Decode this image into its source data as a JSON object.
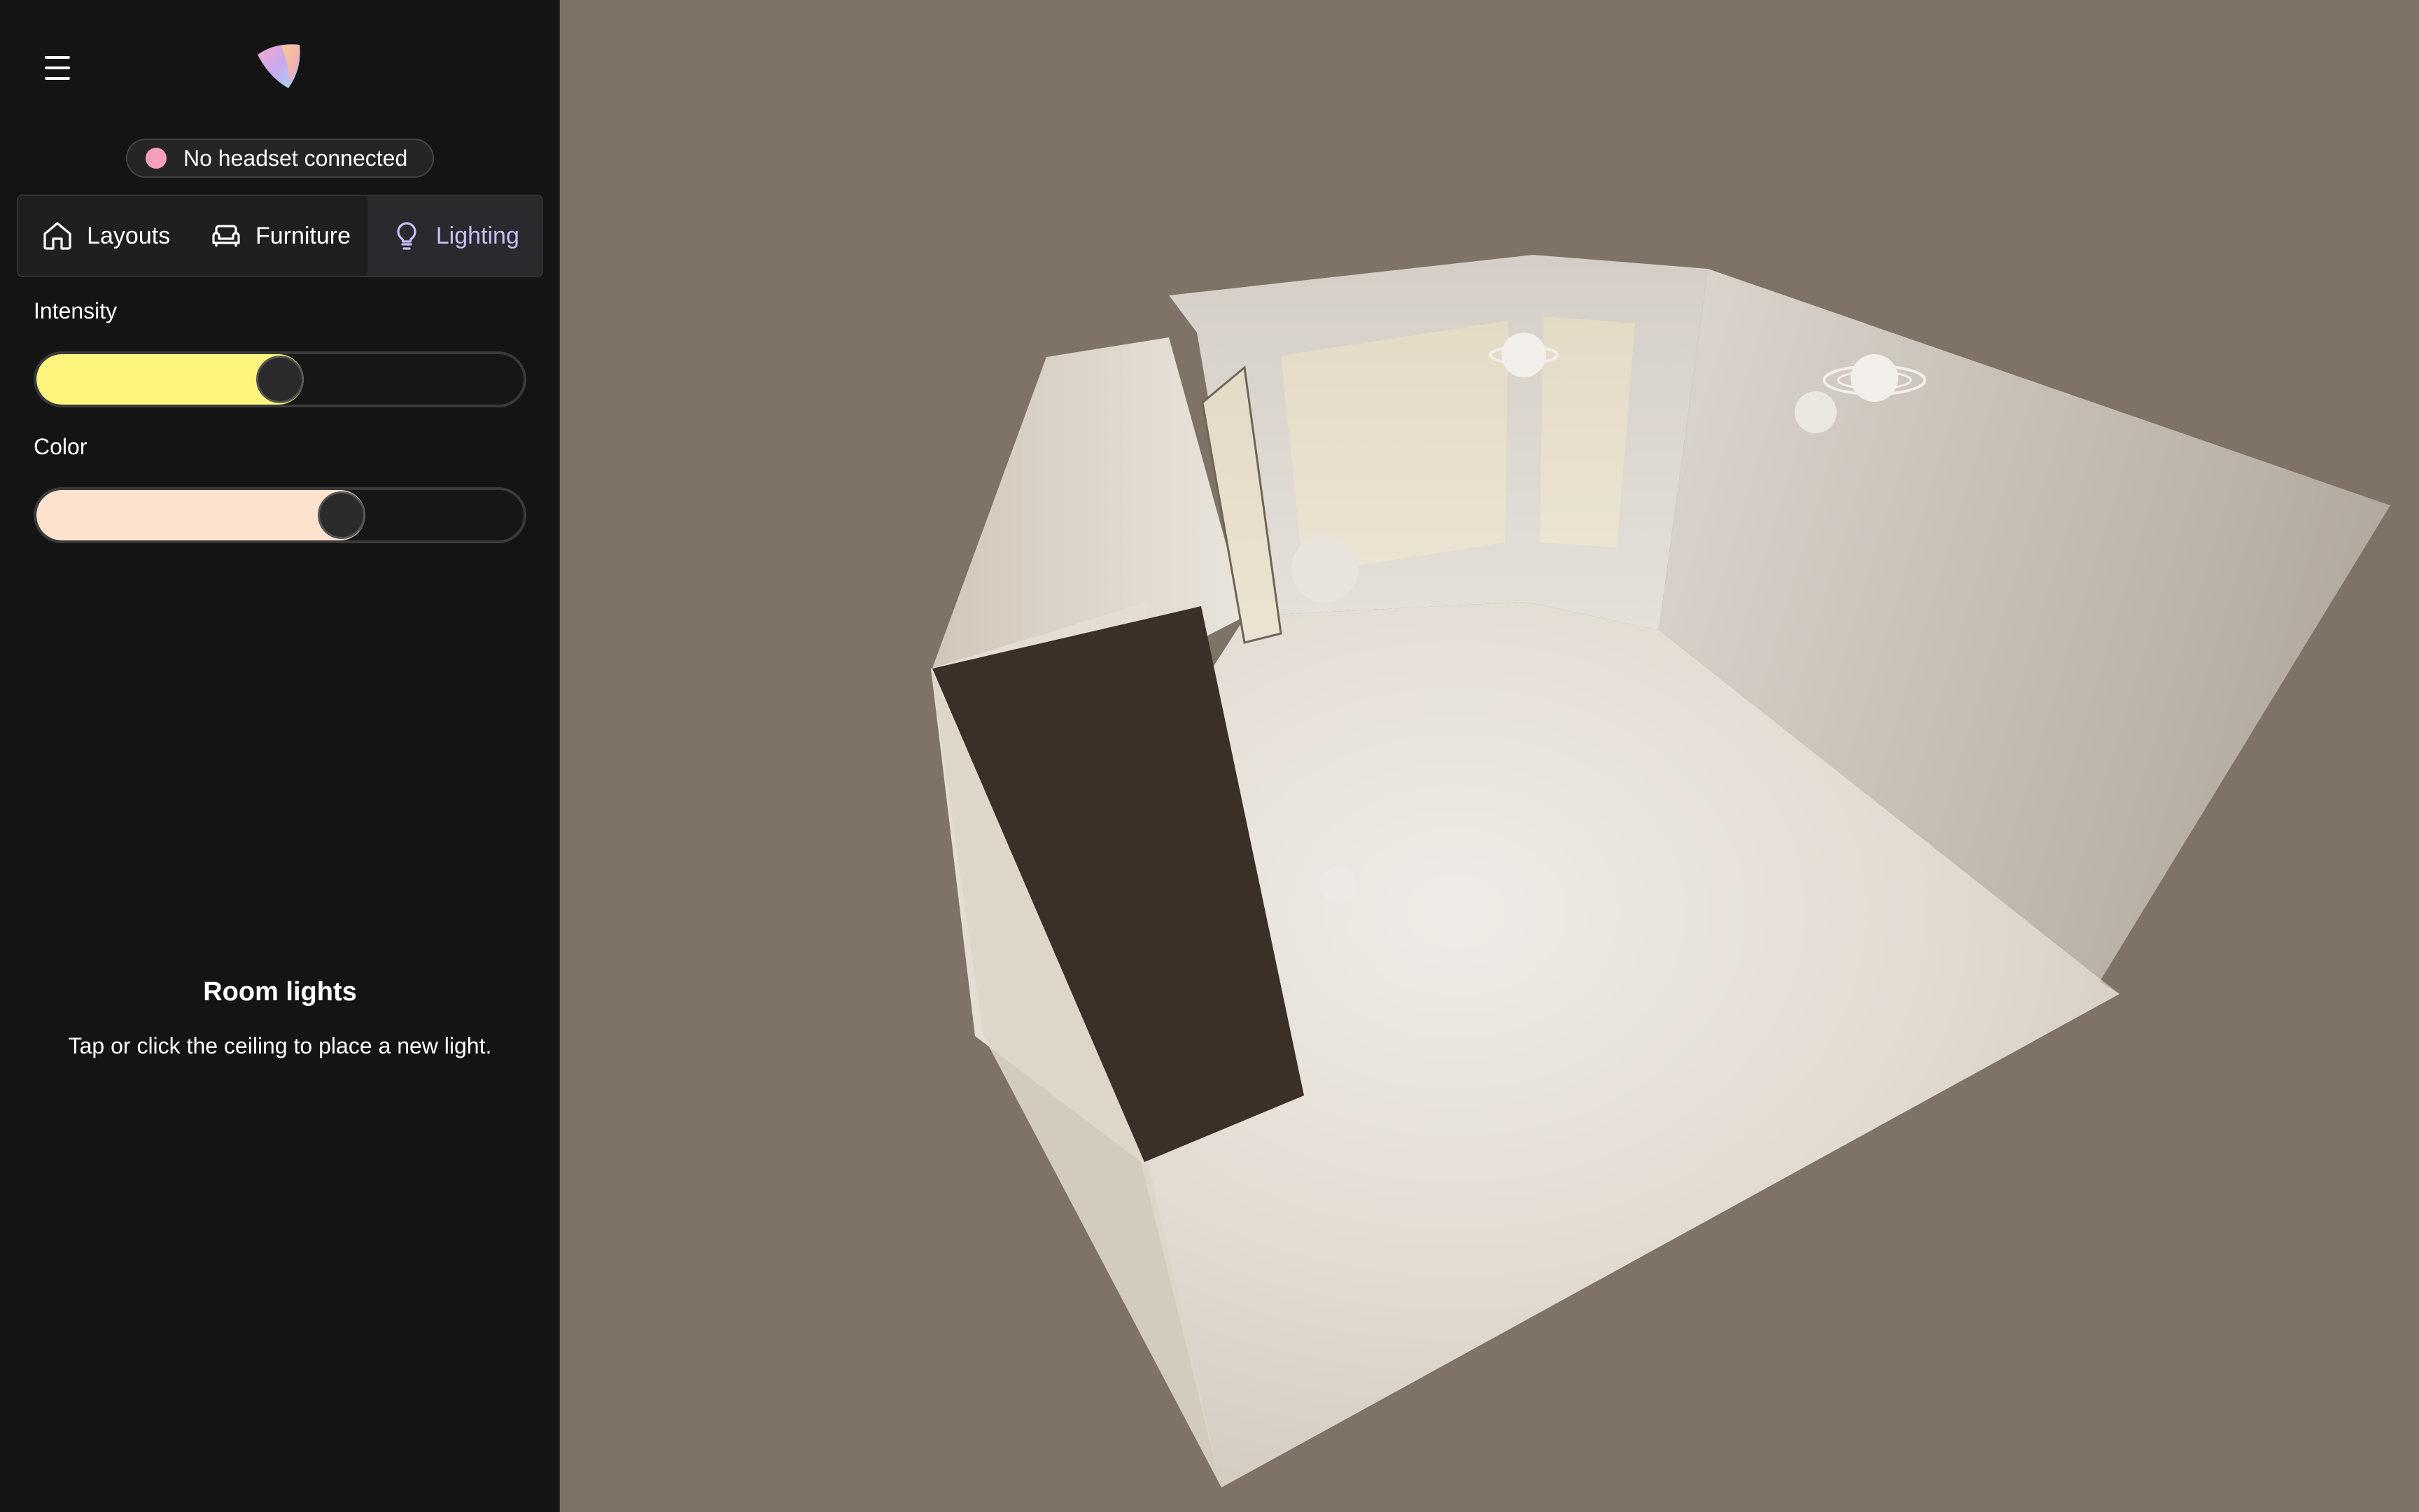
{
  "status": {
    "text": "No headset connected",
    "dot_color": "#f2a0bd"
  },
  "tabs": [
    {
      "label": "Layouts",
      "icon": "home-icon",
      "active": false
    },
    {
      "label": "Furniture",
      "icon": "sofa-icon",
      "active": false
    },
    {
      "label": "Lighting",
      "icon": "lightbulb-icon",
      "active": true
    }
  ],
  "controls": {
    "intensity": {
      "label": "Intensity",
      "value_fraction": 0.5,
      "fill_color": "#fef57e"
    },
    "color": {
      "label": "Color",
      "value_fraction": 0.64,
      "fill_color": "#fde3cd"
    }
  },
  "empty_state": {
    "title": "Room lights",
    "text": "Tap or click the ceiling to place a new light."
  },
  "colors": {
    "accent": "#c7bff4",
    "scene_background": "#7e7366",
    "panel_background": "#141414",
    "object_dark": "#3a3027"
  }
}
